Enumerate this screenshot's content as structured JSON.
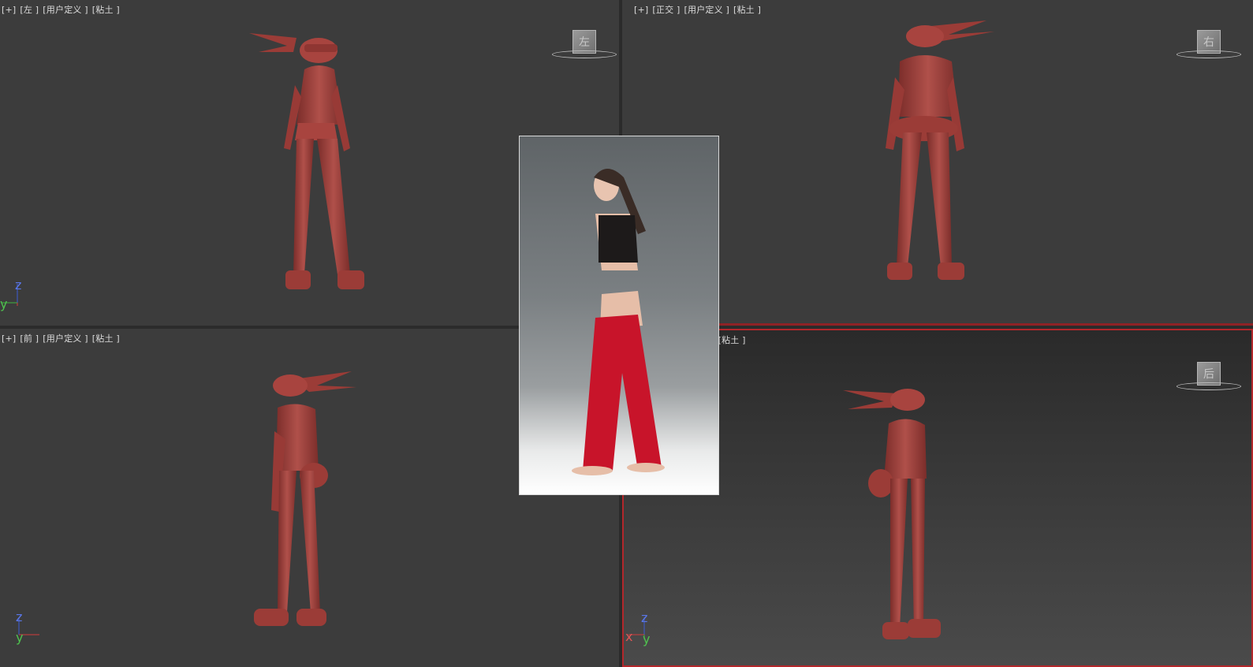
{
  "viewports": {
    "top_left": {
      "labels": [
        "[+]",
        "[左 ]",
        "[用户定义 ]",
        "[粘土 ]"
      ],
      "viewcube_face": "左",
      "axes": {
        "vertical": "z",
        "horizontal": "y"
      }
    },
    "top_right": {
      "labels": [
        "[+]",
        "[正交 ]",
        "[用户定义 ]",
        "[粘土 ]"
      ],
      "viewcube_face": "右"
    },
    "bottom_left": {
      "labels": [
        "[+]",
        "[前 ]",
        "[用户定义 ]",
        "[粘土 ]"
      ],
      "axes": {
        "vertical": "z",
        "horizontal": "y"
      }
    },
    "bottom_right": {
      "labels": [
        "]",
        "[粘土 ]"
      ],
      "viewcube_face": "后",
      "axes": {
        "vertical": "z",
        "horizontal": "x",
        "depth": "y"
      }
    }
  },
  "colors": {
    "clay": "#a8443f",
    "clay_shadow": "#7b2d2a",
    "viewport_bg": "#3c3c3c",
    "active_border": "#b3272b"
  },
  "icons": {
    "viewcube": "viewcube-icon",
    "axis_tripod": "axis-tripod-icon"
  }
}
